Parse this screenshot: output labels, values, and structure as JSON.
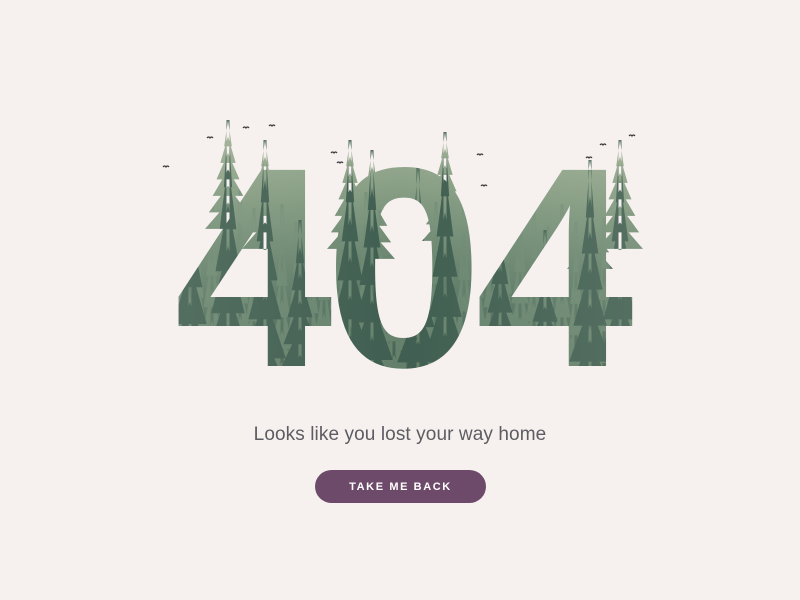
{
  "error": {
    "code": "404",
    "message": "Looks like you lost your way home"
  },
  "actions": {
    "back_label": "TAKE ME BACK"
  },
  "colors": {
    "background": "#f6f1ef",
    "button": "#6d4a69",
    "message_text": "#5c5c62",
    "forest_light": "#8fa68a",
    "forest_dark": "#1f3b2e"
  }
}
